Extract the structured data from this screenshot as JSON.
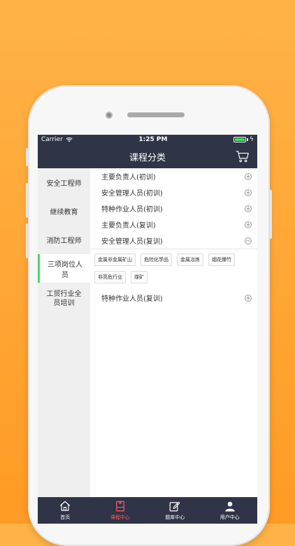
{
  "status": {
    "carrier": "Carrier",
    "time": "1:25 PM"
  },
  "nav": {
    "title": "课程分类"
  },
  "sidebar": {
    "items": [
      {
        "label": "安全工程师"
      },
      {
        "label": "继续教育"
      },
      {
        "label": "消防工程师"
      },
      {
        "label": "三项岗位人员",
        "active": true
      },
      {
        "label": "工贸行业全员培训"
      }
    ]
  },
  "main": {
    "rows": [
      {
        "label": "主要负责人(初训)",
        "icon": "plus"
      },
      {
        "label": "安全管理人员(初训)",
        "icon": "plus"
      },
      {
        "label": "特种作业人员(初训)",
        "icon": "plus"
      },
      {
        "label": "主要负责人(复训)",
        "icon": "plus"
      },
      {
        "label": "安全管理人员(复训)",
        "icon": "minus"
      }
    ],
    "tags": [
      "金属非金属矿山",
      "危险化学品",
      "金属冶炼",
      "烟花爆竹",
      "非高危行业",
      "煤矿"
    ],
    "last_row": {
      "label": "特种作业人员(复训)",
      "icon": "plus"
    }
  },
  "tabbar": {
    "tabs": [
      {
        "label": "首页",
        "icon": "home-icon"
      },
      {
        "label": "课程中心",
        "icon": "course-icon",
        "active": true
      },
      {
        "label": "题库中心",
        "icon": "edit-icon"
      },
      {
        "label": "用户中心",
        "icon": "user-icon"
      }
    ]
  },
  "colors": {
    "bar": "#2f3446",
    "accent": "#ff5a5f",
    "active_indicator": "#4cd964"
  }
}
